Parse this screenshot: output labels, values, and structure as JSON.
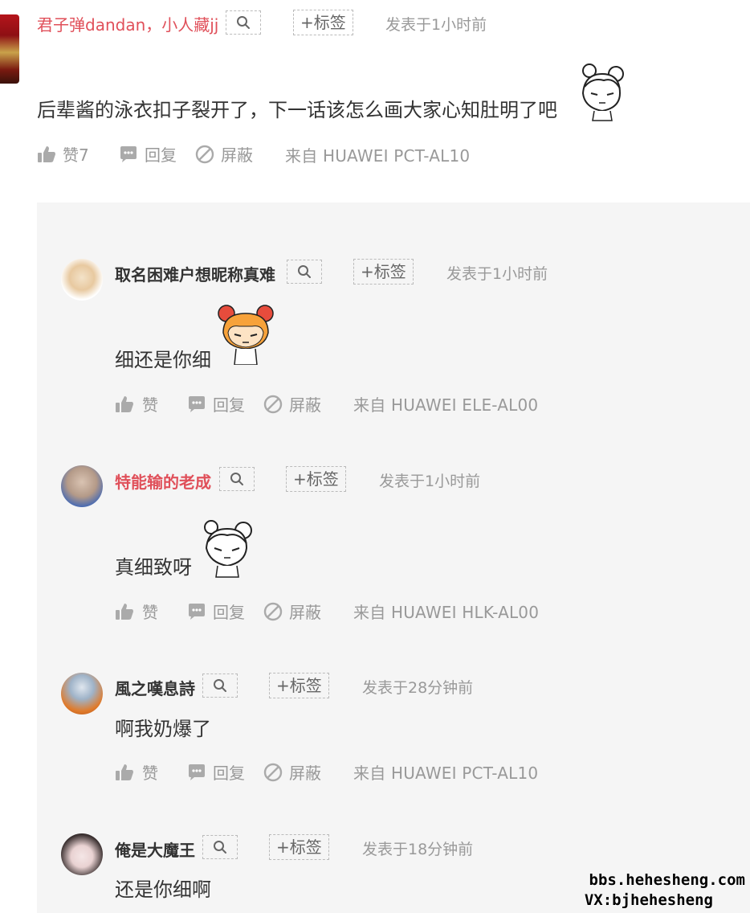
{
  "main_post": {
    "username": "君子弹dandan，小人藏jj",
    "tag_label": "+标签",
    "time": "发表于1小时前",
    "content": "后辈酱的泳衣扣子裂开了，下一话该怎么画大家心知肚明了吧",
    "like_label": "赞7",
    "reply_label": "回复",
    "block_label": "屏蔽",
    "device": "来自 HUAWEI  PCT-AL10"
  },
  "replies": [
    {
      "username": "取名困难户想昵称真难",
      "tag_label": "+标签",
      "time": "发表于1小时前",
      "content": "细还是你细",
      "like_label": "赞",
      "reply_label": "回复",
      "block_label": "屏蔽",
      "device": "来自 HUAWEI  ELE-AL00"
    },
    {
      "username": "特能输的老成",
      "tag_label": "+标签",
      "time": "发表于1小时前",
      "content": "真细致呀",
      "like_label": "赞",
      "reply_label": "回复",
      "block_label": "屏蔽",
      "device": "来自 HUAWEI  HLK-AL00"
    },
    {
      "username": "風之嘆息詩",
      "tag_label": "+标签",
      "time": "发表于28分钟前",
      "content": "啊我奶爆了",
      "like_label": "赞",
      "reply_label": "回复",
      "block_label": "屏蔽",
      "device": "来自 HUAWEI  PCT-AL10"
    },
    {
      "username": "俺是大魔王",
      "tag_label": "+标签",
      "time": "发表于18分钟前",
      "content": "还是你细啊"
    }
  ],
  "watermark": {
    "line1": "bbs.hehesheng.com",
    "line2": "VX:bjhehesheng"
  },
  "colors": {
    "accent_username": "#e0505a",
    "panel_bg": "#f5f5f5",
    "muted_text": "#999999"
  },
  "icons": [
    "search-icon",
    "thumbs-up-icon",
    "comment-icon",
    "block-icon",
    "sticker-emoticon"
  ]
}
